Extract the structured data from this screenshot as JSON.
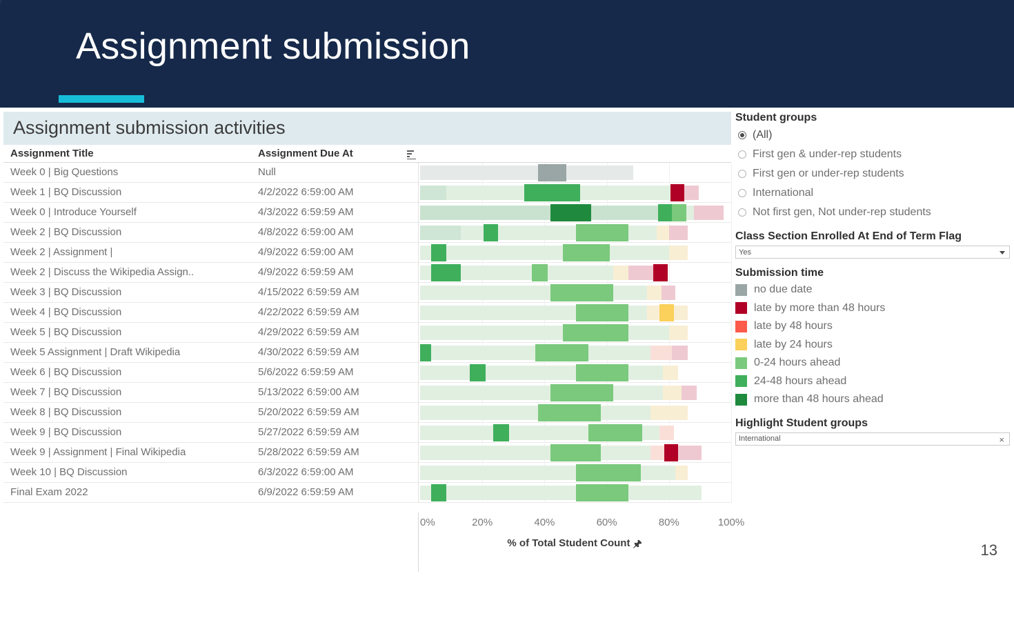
{
  "slide": {
    "title": "Assignment submission",
    "page_number": "13",
    "header_bg": "#16294a",
    "accent_color": "#17bdd8"
  },
  "viz": {
    "title": "Assignment submission activities",
    "columns": [
      "Assignment Title",
      "Assignment Due At"
    ],
    "sort_icon": "sort-descending-icon",
    "axis": {
      "ticks": [
        "0%",
        "20%",
        "40%",
        "60%",
        "80%",
        "100%"
      ],
      "label": "% of Total Student Count",
      "label_icon": "pin-icon",
      "min": 0,
      "max": 100
    }
  },
  "colors": {
    "no_due_date": "#9aa5a5",
    "late_48_plus": "#b10026",
    "late_48": "#fc5a4b",
    "late_24": "#fbd05b",
    "ahead_0_24": "#7bc97d",
    "ahead_24_48": "#3faf5c",
    "ahead_48_plus": "#1f8a3d",
    "faded_no_due_date": "#e5e9e8",
    "faded_late_48_plus": "#efc9d1",
    "faded_late_48": "#fadfd9",
    "faded_late_24": "#f8eed4",
    "faded_ahead_0_24": "#e1efe1",
    "faded_ahead_24_48": "#cfe5d5",
    "faded_ahead_48_plus": "#c9e2cf"
  },
  "chart_data": {
    "type": "bar",
    "title": "Assignment submission activities",
    "xlabel": "% of Total Student Count",
    "ylabel": "Assignment Title",
    "xlim": [
      0,
      100
    ],
    "stacked": true,
    "orientation": "horizontal",
    "legend_title": "Submission time",
    "legend": [
      "no due date",
      "late by more than 48 hours",
      "late by 48 hours",
      "late by 24 hours",
      "0-24 hours ahead",
      "24-48 hours ahead",
      "more than 48 hours ahead"
    ],
    "categories": [
      "Week 0 | Big Questions",
      "Week 1 | BQ Discussion",
      "Week 0 | Introduce Yourself",
      "Week 2 | BQ Discussion",
      "Week 2 | Assignment |",
      "Week 2 | Discuss the Wikipedia Assign..",
      "Week 3 | BQ Discussion",
      "Week 4 | BQ Discussion",
      "Week 5 | BQ Discussion",
      "Week 5 Assignment | Draft Wikipedia",
      "Week 6 | BQ Discussion",
      "Week 7 | BQ Discussion",
      "Week 8 | BQ Discussion",
      "Week 9 | BQ Discussion",
      "Week 9 | Assignment | Final Wikipedia",
      "Week 10 | BQ Discussion",
      "Final Exam 2022"
    ],
    "rows": [
      {
        "title": "Week 0 | Big Questions",
        "due": "Null",
        "segments": [
          {
            "key": "no_due_date",
            "start": 0,
            "end": 68.5,
            "highlight": false
          },
          {
            "key": "no_due_date",
            "start": 38.0,
            "end": 47.0,
            "highlight": true
          }
        ]
      },
      {
        "title": "Week 1 | BQ Discussion",
        "due": "4/2/2022 6:59:00 AM",
        "segments": [
          {
            "key": "ahead_24_48",
            "start": 0,
            "end": 8.5,
            "highlight": false
          },
          {
            "key": "ahead_0_24",
            "start": 8.5,
            "end": 71.0,
            "highlight": false
          },
          {
            "key": "ahead_24_48",
            "start": 33.5,
            "end": 51.5,
            "highlight": true
          },
          {
            "key": "ahead_0_24",
            "start": 71.0,
            "end": 80.5,
            "highlight": false
          },
          {
            "key": "late_48_plus",
            "start": 80.5,
            "end": 85.0,
            "highlight": true
          },
          {
            "key": "late_48_plus",
            "start": 85.0,
            "end": 89.5,
            "highlight": false
          }
        ]
      },
      {
        "title": "Week 0 | Introduce Yourself",
        "due": "4/3/2022 6:59:59 AM",
        "segments": [
          {
            "key": "ahead_48_plus",
            "start": 0,
            "end": 76.5,
            "highlight": false
          },
          {
            "key": "ahead_48_plus",
            "start": 42.0,
            "end": 55.0,
            "highlight": true
          },
          {
            "key": "ahead_24_48",
            "start": 76.5,
            "end": 81.0,
            "highlight": true
          },
          {
            "key": "ahead_0_24",
            "start": 81.0,
            "end": 85.5,
            "highlight": true
          },
          {
            "key": "ahead_0_24",
            "start": 85.5,
            "end": 88.0,
            "highlight": false
          },
          {
            "key": "late_48_plus",
            "start": 88.0,
            "end": 97.5,
            "highlight": false
          }
        ]
      },
      {
        "title": "Week 2 | BQ Discussion",
        "due": "4/8/2022 6:59:00 AM",
        "segments": [
          {
            "key": "ahead_24_48",
            "start": 0,
            "end": 13.0,
            "highlight": false
          },
          {
            "key": "ahead_0_24",
            "start": 13.0,
            "end": 76.0,
            "highlight": false
          },
          {
            "key": "ahead_24_48",
            "start": 20.5,
            "end": 25.0,
            "highlight": true
          },
          {
            "key": "ahead_0_24",
            "start": 50.0,
            "end": 67.0,
            "highlight": true
          },
          {
            "key": "late_24",
            "start": 76.0,
            "end": 80.0,
            "highlight": false
          },
          {
            "key": "late_48_plus",
            "start": 80.0,
            "end": 86.0,
            "highlight": false
          }
        ]
      },
      {
        "title": "Week 2 | Assignment |",
        "due": "4/9/2022 6:59:00 AM",
        "segments": [
          {
            "key": "ahead_0_24",
            "start": 0,
            "end": 80.0,
            "highlight": false
          },
          {
            "key": "ahead_24_48",
            "start": 3.5,
            "end": 8.5,
            "highlight": true
          },
          {
            "key": "ahead_0_24",
            "start": 46.0,
            "end": 61.0,
            "highlight": true
          },
          {
            "key": "late_24",
            "start": 80.0,
            "end": 86.0,
            "highlight": false
          }
        ]
      },
      {
        "title": "Week 2 | Discuss the Wikipedia Assign..",
        "due": "4/9/2022 6:59:59 AM",
        "segments": [
          {
            "key": "ahead_0_24",
            "start": 0,
            "end": 62.0,
            "highlight": false
          },
          {
            "key": "ahead_24_48",
            "start": 3.5,
            "end": 13.0,
            "highlight": true
          },
          {
            "key": "ahead_0_24",
            "start": 36.0,
            "end": 41.0,
            "highlight": true
          },
          {
            "key": "late_24",
            "start": 62.0,
            "end": 67.0,
            "highlight": false
          },
          {
            "key": "late_48_plus",
            "start": 67.0,
            "end": 75.0,
            "highlight": false
          },
          {
            "key": "late_48_plus",
            "start": 75.0,
            "end": 79.5,
            "highlight": true
          }
        ]
      },
      {
        "title": "Week 3 | BQ Discussion",
        "due": "4/15/2022 6:59:59 AM",
        "segments": [
          {
            "key": "ahead_0_24",
            "start": 0,
            "end": 73.0,
            "highlight": false
          },
          {
            "key": "ahead_0_24",
            "start": 42.0,
            "end": 62.0,
            "highlight": true
          },
          {
            "key": "late_24",
            "start": 73.0,
            "end": 77.5,
            "highlight": false
          },
          {
            "key": "late_48_plus",
            "start": 77.5,
            "end": 82.0,
            "highlight": false
          }
        ]
      },
      {
        "title": "Week 4 | BQ Discussion",
        "due": "4/22/2022 6:59:59 AM",
        "segments": [
          {
            "key": "ahead_0_24",
            "start": 0,
            "end": 73.0,
            "highlight": false
          },
          {
            "key": "ahead_0_24",
            "start": 50.0,
            "end": 67.0,
            "highlight": true
          },
          {
            "key": "late_24",
            "start": 73.0,
            "end": 77.0,
            "highlight": false
          },
          {
            "key": "late_24",
            "start": 77.0,
            "end": 81.5,
            "highlight": true
          },
          {
            "key": "late_24",
            "start": 81.5,
            "end": 86.0,
            "highlight": false
          }
        ]
      },
      {
        "title": "Week 5 | BQ Discussion",
        "due": "4/29/2022 6:59:59 AM",
        "segments": [
          {
            "key": "ahead_0_24",
            "start": 0,
            "end": 80.0,
            "highlight": false
          },
          {
            "key": "ahead_0_24",
            "start": 46.0,
            "end": 67.0,
            "highlight": true
          },
          {
            "key": "late_24",
            "start": 80.0,
            "end": 86.0,
            "highlight": false
          }
        ]
      },
      {
        "title": "Week 5 Assignment | Draft Wikipedia",
        "due": "4/30/2022 6:59:59 AM",
        "segments": [
          {
            "key": "ahead_0_24",
            "start": 0,
            "end": 74.0,
            "highlight": false
          },
          {
            "key": "ahead_24_48",
            "start": 0,
            "end": 3.5,
            "highlight": true
          },
          {
            "key": "ahead_0_24",
            "start": 37.0,
            "end": 54.0,
            "highlight": true
          },
          {
            "key": "late_48",
            "start": 74.0,
            "end": 81.0,
            "highlight": false
          },
          {
            "key": "late_48_plus",
            "start": 81.0,
            "end": 86.0,
            "highlight": false
          }
        ]
      },
      {
        "title": "Week 6 | BQ Discussion",
        "due": "5/6/2022 6:59:59 AM",
        "segments": [
          {
            "key": "ahead_0_24",
            "start": 0,
            "end": 78.0,
            "highlight": false
          },
          {
            "key": "ahead_24_48",
            "start": 16.0,
            "end": 21.0,
            "highlight": true
          },
          {
            "key": "ahead_0_24",
            "start": 50.0,
            "end": 67.0,
            "highlight": true
          },
          {
            "key": "late_24",
            "start": 78.0,
            "end": 83.0,
            "highlight": false
          }
        ]
      },
      {
        "title": "Week 7 | BQ Discussion",
        "due": "5/13/2022 6:59:00 AM",
        "segments": [
          {
            "key": "ahead_0_24",
            "start": 0,
            "end": 78.0,
            "highlight": false
          },
          {
            "key": "ahead_0_24",
            "start": 42.0,
            "end": 62.0,
            "highlight": true
          },
          {
            "key": "late_24",
            "start": 78.0,
            "end": 84.0,
            "highlight": false
          },
          {
            "key": "late_48_plus",
            "start": 84.0,
            "end": 89.0,
            "highlight": false
          }
        ]
      },
      {
        "title": "Week 8 | BQ Discussion",
        "due": "5/20/2022 6:59:59 AM",
        "segments": [
          {
            "key": "ahead_0_24",
            "start": 0,
            "end": 74.0,
            "highlight": false
          },
          {
            "key": "ahead_0_24",
            "start": 38.0,
            "end": 58.0,
            "highlight": true
          },
          {
            "key": "late_24",
            "start": 74.0,
            "end": 86.0,
            "highlight": false
          }
        ]
      },
      {
        "title": "Week 9 | BQ Discussion",
        "due": "5/27/2022 6:59:59 AM",
        "segments": [
          {
            "key": "ahead_0_24",
            "start": 0,
            "end": 77.0,
            "highlight": false
          },
          {
            "key": "ahead_24_48",
            "start": 23.5,
            "end": 28.5,
            "highlight": true
          },
          {
            "key": "ahead_0_24",
            "start": 54.0,
            "end": 71.5,
            "highlight": true
          },
          {
            "key": "late_48",
            "start": 77.0,
            "end": 81.5,
            "highlight": false
          }
        ]
      },
      {
        "title": "Week 9 | Assignment | Final Wikipedia",
        "due": "5/28/2022 6:59:59 AM",
        "segments": [
          {
            "key": "ahead_0_24",
            "start": 0,
            "end": 74.0,
            "highlight": false
          },
          {
            "key": "ahead_0_24",
            "start": 42.0,
            "end": 58.0,
            "highlight": true
          },
          {
            "key": "late_48",
            "start": 74.0,
            "end": 78.5,
            "highlight": false
          },
          {
            "key": "late_48_plus",
            "start": 78.5,
            "end": 83.0,
            "highlight": true
          },
          {
            "key": "late_48_plus",
            "start": 83.0,
            "end": 90.5,
            "highlight": false
          }
        ]
      },
      {
        "title": "Week 10 | BQ Discussion",
        "due": "6/3/2022 6:59:00 AM",
        "segments": [
          {
            "key": "ahead_0_24",
            "start": 0,
            "end": 82.0,
            "highlight": false
          },
          {
            "key": "ahead_0_24",
            "start": 50.0,
            "end": 71.0,
            "highlight": true
          },
          {
            "key": "late_24",
            "start": 82.0,
            "end": 86.0,
            "highlight": false
          }
        ]
      },
      {
        "title": "Final Exam 2022",
        "due": "6/9/2022 6:59:59 AM",
        "segments": [
          {
            "key": "ahead_0_24",
            "start": 0,
            "end": 90.5,
            "highlight": false
          },
          {
            "key": "ahead_24_48",
            "start": 3.5,
            "end": 8.5,
            "highlight": true
          },
          {
            "key": "ahead_0_24",
            "start": 50.0,
            "end": 67.0,
            "highlight": true
          }
        ]
      }
    ]
  },
  "panel": {
    "student_groups": {
      "title": "Student groups",
      "options": [
        {
          "label": "(All)",
          "selected": true
        },
        {
          "label": "First gen & under-rep students",
          "selected": false
        },
        {
          "label": "First gen or under-rep students",
          "selected": false
        },
        {
          "label": "International",
          "selected": false
        },
        {
          "label": "Not first gen, Not under-rep students",
          "selected": false
        }
      ]
    },
    "class_section": {
      "title": "Class Section Enrolled At End of Term Flag",
      "value": "Yes"
    },
    "submission_time": {
      "title": "Submission time",
      "items": [
        {
          "label": "no due date",
          "color_key": "no_due_date"
        },
        {
          "label": "late by more than 48 hours",
          "color_key": "late_48_plus"
        },
        {
          "label": "late by 48 hours",
          "color_key": "late_48"
        },
        {
          "label": "late by 24 hours",
          "color_key": "late_24"
        },
        {
          "label": "0-24 hours ahead",
          "color_key": "ahead_0_24"
        },
        {
          "label": "24-48 hours ahead",
          "color_key": "ahead_24_48"
        },
        {
          "label": "more than 48 hours ahead",
          "color_key": "ahead_48_plus"
        }
      ]
    },
    "highlight_groups": {
      "title": "Highlight Student groups",
      "value": "International",
      "clear_icon": "close-icon"
    }
  }
}
